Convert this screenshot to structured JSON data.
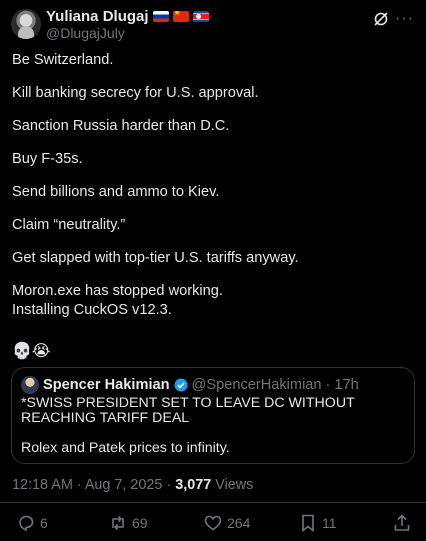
{
  "author": {
    "name": "Yuliana Dlugaj",
    "handle": "@DlugajJuly",
    "flags": [
      "russia-flag-icon",
      "china-flag-icon",
      "north-korea-flag-icon"
    ]
  },
  "tweet": {
    "paragraphs": [
      "Be Switzerland.",
      "Kill banking secrecy for U.S. approval.",
      "Sanction Russia harder than D.C.",
      "Buy F-35s.",
      "Send billions and ammo to Kiev.",
      "Claim “neutrality.”",
      "Get slapped with top-tier U.S. tariffs anyway.",
      "Moron.exe has stopped working.",
      "Installing CuckOS v12.3."
    ],
    "emojis": "💀😭"
  },
  "quote": {
    "name": "Spencer Hakimian",
    "handle": "@SpencerHakimian",
    "time": "17h",
    "text": "*SWISS PRESIDENT SET TO LEAVE DC WITHOUT REACHING TARIFF DEAL",
    "text2": "Rolex and Patek prices to infinity."
  },
  "meta": {
    "time": "12:18 AM",
    "date": "Aug 7, 2025",
    "views_count": "3,077",
    "views_label": "Views"
  },
  "actions": {
    "replies": "6",
    "reposts": "69",
    "likes": "264",
    "bookmarks": "11"
  },
  "colors": {
    "background": "#000000",
    "text": "#e7e9ea",
    "muted": "#71767b",
    "border": "#2f3336",
    "verified": "#1d9bf0"
  }
}
